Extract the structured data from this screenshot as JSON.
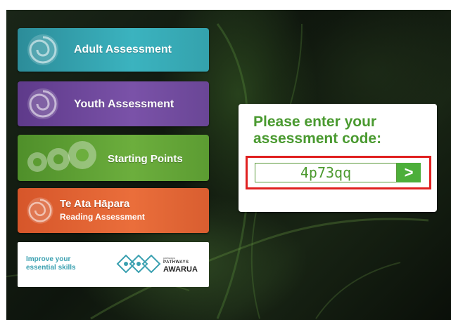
{
  "menu": {
    "adult": {
      "label": "Adult Assessment",
      "icon": "koru-icon"
    },
    "youth": {
      "label": "Youth Assessment",
      "icon": "koru-icon"
    },
    "starting_points": {
      "label": "Starting Points",
      "icon": "koru-trio-icon"
    },
    "te_ata_hapara": {
      "label": "Te Ata Hāpara",
      "sublabel": "Reading Assessment",
      "icon": "koru-icon"
    }
  },
  "promo": {
    "tagline_line1": "Improve your",
    "tagline_line2": "essential skills",
    "brand_small": "pathways",
    "brand_mid": "PATHWAYS",
    "brand_big": "AWARUA"
  },
  "code_panel": {
    "prompt": "Please enter your assessment code:",
    "code_value": "4p73qq",
    "submit_glyph": ">"
  },
  "colors": {
    "adult": "#3bb3bf",
    "youth": "#7a52a8",
    "starting_points": "#6cae3d",
    "te_ata_hapara": "#ea6e3b",
    "prompt_green": "#4a9a30",
    "highlight_red": "#e02020"
  }
}
